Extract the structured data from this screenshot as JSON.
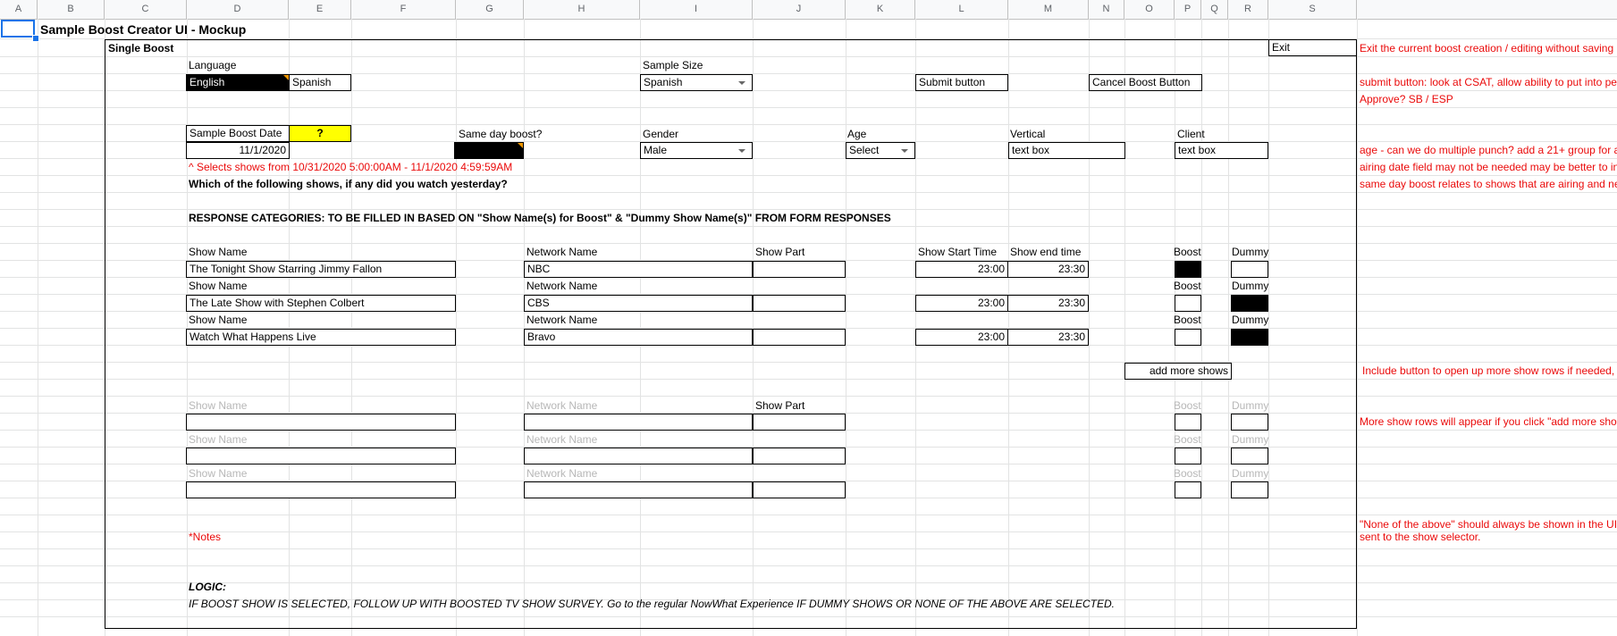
{
  "columns": [
    "A",
    "B",
    "C",
    "D",
    "E",
    "F",
    "G",
    "H",
    "I",
    "J",
    "K",
    "L",
    "M",
    "N",
    "O",
    "P",
    "Q",
    "R",
    "S"
  ],
  "title": "Sample Boost Creator UI - Mockup",
  "section_label": "Single Boost",
  "exit_label": "Exit",
  "language": {
    "label": "Language",
    "options": [
      "English",
      "Spanish"
    ],
    "selected": "English"
  },
  "sample_size": {
    "label": "Sample Size",
    "value": "Spanish"
  },
  "submit_label": "Submit button",
  "cancel_label": "Cancel Boost Button",
  "sample_boost_date": {
    "label": "Sample Boost Date",
    "help": "?",
    "value": "11/1/2020"
  },
  "same_day_boost": {
    "label": "Same day boost?"
  },
  "gender": {
    "label": "Gender",
    "value": "Male"
  },
  "age": {
    "label": "Age",
    "value": "Select"
  },
  "vertical": {
    "label": "Vertical",
    "value": "text box"
  },
  "client": {
    "label": "Client",
    "value": "text box"
  },
  "date_range_note": "^ Selects shows from 10/31/2020 5:00:00AM - 11/1/2020 4:59:59AM",
  "question": "Which of the following shows, if any did you watch yesterday?",
  "response_categories": "RESPONSE CATEGORIES: TO BE FILLED IN BASED ON \"Show Name(s) for Boost\" & \"Dummy Show Name(s)\" FROM FORM RESPONSES",
  "headers": {
    "show_name": "Show Name",
    "network_name": "Network Name",
    "show_part": "Show Part",
    "show_start": "Show Start Time",
    "show_end": "Show end time",
    "boost": "Boost",
    "dummy": "Dummy"
  },
  "shows": [
    {
      "name": "The Tonight Show Starring Jimmy Fallon",
      "network": "NBC",
      "part": "",
      "start": "23:00",
      "end": "23:30",
      "boost": true,
      "dummy": false
    },
    {
      "name": "The Late Show with Stephen Colbert",
      "network": "CBS",
      "part": "",
      "start": "23:00",
      "end": "23:30",
      "boost": false,
      "dummy": true
    },
    {
      "name": "Watch What Happens Live",
      "network": "Bravo",
      "part": "",
      "start": "23:00",
      "end": "23:30",
      "boost": false,
      "dummy": true
    }
  ],
  "add_more_label": "add more shows",
  "notes_label": "*Notes",
  "logic_label": "LOGIC:",
  "logic_text": "IF BOOST SHOW IS SELECTED, FOLLOW UP WITH BOOSTED TV SHOW SURVEY.  Go to the regular NowWhat Experience IF DUMMY SHOWS OR NONE OF THE ABOVE ARE SELECTED.",
  "side_notes": {
    "exit": "Exit the current boost creation / editing without saving",
    "submit1": "submit button: look at CSAT, allow ability to put into pe",
    "submit2": "Approve? SB / ESP",
    "age": "age - can we do multiple punch? add a 21+ group for a",
    "airing": "airing date field may not be needed may be better to in",
    "sameday": "same day boost relates to shows that are airing and ne",
    "include": "Include button to open up more show rows if needed,",
    "more_rows": "More show rows will appear if you click \"add more sho",
    "none1": "\"None of the above\" should always be shown in the UI",
    "none2": "sent to the show selector."
  }
}
